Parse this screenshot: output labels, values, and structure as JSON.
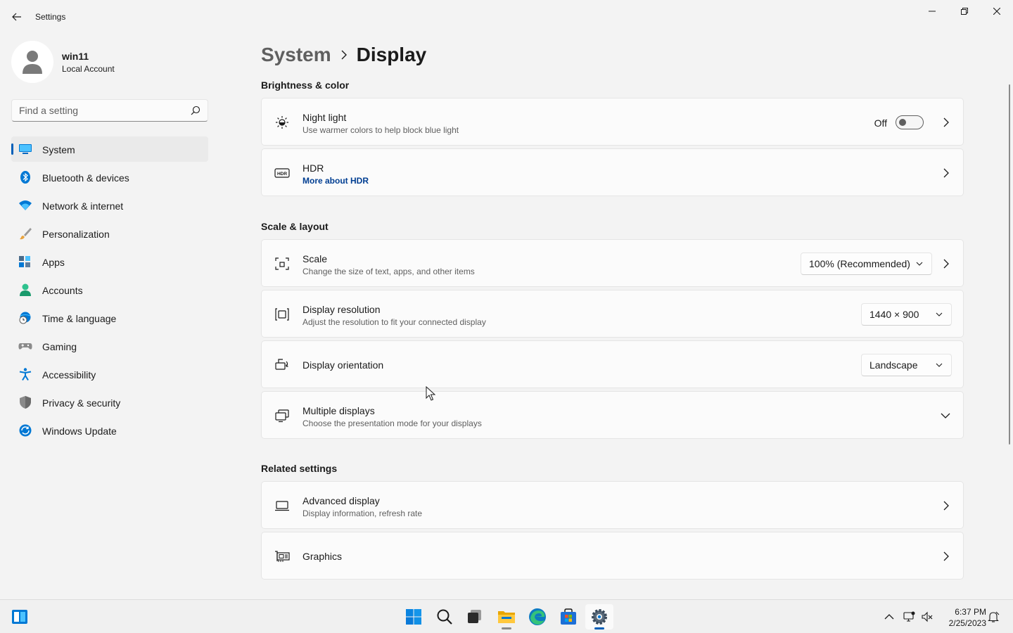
{
  "window": {
    "title": "Settings"
  },
  "profile": {
    "name": "win11",
    "account_type": "Local Account"
  },
  "search": {
    "placeholder": "Find a setting"
  },
  "sidebar": {
    "items": [
      {
        "label": "System",
        "icon": "monitor-icon",
        "selected": true
      },
      {
        "label": "Bluetooth & devices",
        "icon": "bluetooth-icon"
      },
      {
        "label": "Network & internet",
        "icon": "wifi-icon"
      },
      {
        "label": "Personalization",
        "icon": "brush-icon"
      },
      {
        "label": "Apps",
        "icon": "apps-icon"
      },
      {
        "label": "Accounts",
        "icon": "person-icon"
      },
      {
        "label": "Time & language",
        "icon": "globe-clock-icon"
      },
      {
        "label": "Gaming",
        "icon": "gamepad-icon"
      },
      {
        "label": "Accessibility",
        "icon": "accessibility-icon"
      },
      {
        "label": "Privacy & security",
        "icon": "shield-icon"
      },
      {
        "label": "Windows Update",
        "icon": "update-icon"
      }
    ]
  },
  "breadcrumb": {
    "parent": "System",
    "current": "Display"
  },
  "sections": {
    "brightness": "Brightness & color",
    "scale_layout": "Scale & layout",
    "related": "Related settings"
  },
  "cards": {
    "night_light": {
      "title": "Night light",
      "subtitle": "Use warmer colors to help block blue light",
      "toggle_label": "Off",
      "toggle_on": false
    },
    "hdr": {
      "title": "HDR",
      "link": "More about HDR"
    },
    "scale": {
      "title": "Scale",
      "subtitle": "Change the size of text, apps, and other items",
      "value": "100% (Recommended)"
    },
    "resolution": {
      "title": "Display resolution",
      "subtitle": "Adjust the resolution to fit your connected display",
      "value": "1440 × 900"
    },
    "orientation": {
      "title": "Display orientation",
      "value": "Landscape"
    },
    "multiple": {
      "title": "Multiple displays",
      "subtitle": "Choose the presentation mode for your displays"
    },
    "advanced": {
      "title": "Advanced display",
      "subtitle": "Display information, refresh rate"
    },
    "graphics": {
      "title": "Graphics"
    }
  },
  "taskbar": {
    "time": "6:37 PM",
    "date": "2/25/2023"
  },
  "colors": {
    "accent": "#005fb8",
    "link": "#003e92"
  }
}
